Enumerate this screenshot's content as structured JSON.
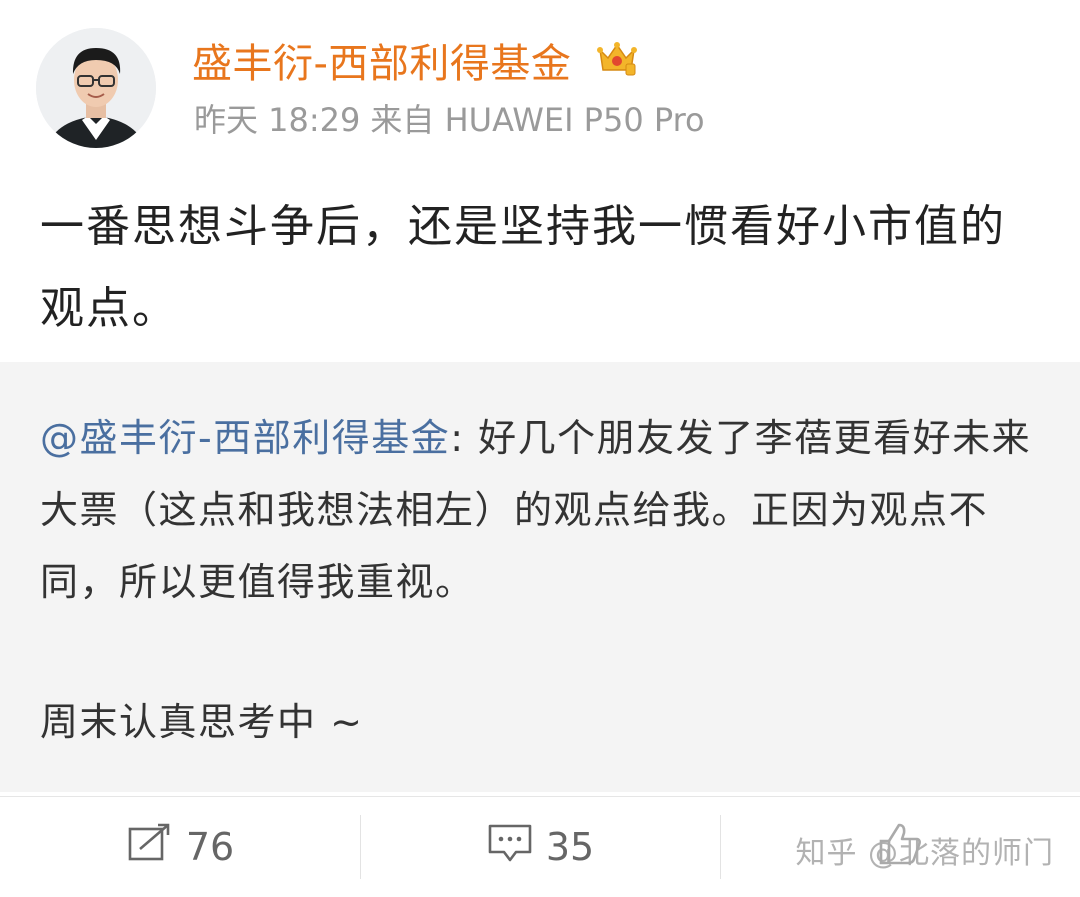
{
  "post": {
    "author": "盛丰衍-西部利得基金",
    "author_badge_icon": "crown-icon",
    "time": "昨天 18:29",
    "source": "来自 HUAWEI P50 Pro",
    "text": "一番思想斗争后，还是坚持我一惯看好小市值的观点。"
  },
  "repost": {
    "mention": "@盛丰衍-西部利得基金",
    "text": ": 好几个朋友发了李蓓更看好未来大票（这点和我想法相左）的观点给我。正因为观点不同，所以更值得我重视。",
    "extra": "周末认真思考中 ~"
  },
  "actions": {
    "repost_count": "76",
    "comment_count": "35",
    "repost_icon": "share-icon",
    "comment_icon": "comment-icon",
    "like_icon": "like-icon"
  },
  "watermark": "知乎 @北落的师门",
  "colors": {
    "author": "#e8761d",
    "mention": "#4a6fa0",
    "repost_background": "#f4f4f4"
  }
}
